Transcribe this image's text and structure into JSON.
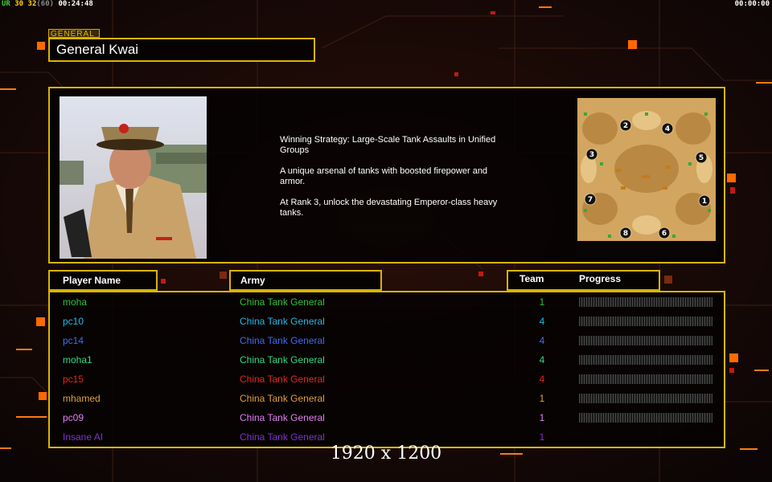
{
  "hud": {
    "left_ur": "UR",
    "left_fps1": "30",
    "left_fps2": "32",
    "left_fps3": "(60)",
    "left_time": "00:24:48",
    "right_time": "00:00:00"
  },
  "general": {
    "tag": "GENERAL",
    "name": "General Kwai",
    "description": [
      "Winning Strategy: Large-Scale Tank Assaults in Unified\n Groups",
      "A unique arsenal of tanks with boosted firepower and\n armor.",
      "At Rank 3, unlock the devastating Emperor-class heavy\n tanks."
    ]
  },
  "map": {
    "start_positions": [
      "1",
      "2",
      "3",
      "4",
      "5",
      "6",
      "7",
      "8"
    ]
  },
  "table": {
    "headers": {
      "player_name": "Player Name",
      "army": "Army",
      "team": "Team",
      "progress": "Progress"
    },
    "rows": [
      {
        "player": "moha",
        "army": "China Tank General",
        "team": "1",
        "color": "#2ec23a"
      },
      {
        "player": "pc10",
        "army": "China Tank General",
        "team": "4",
        "color": "#22b8e6"
      },
      {
        "player": "pc14",
        "army": "China Tank General",
        "team": "4",
        "color": "#3f6bf0"
      },
      {
        "player": "moha1",
        "army": "China Tank General",
        "team": "4",
        "color": "#2ed986"
      },
      {
        "player": "pc15",
        "army": "China Tank General",
        "team": "4",
        "color": "#e6261e"
      },
      {
        "player": "mhamed",
        "army": "China Tank General",
        "team": "1",
        "color": "#e0a040"
      },
      {
        "player": "pc09",
        "army": "China Tank General",
        "team": "1",
        "color": "#e080f0"
      },
      {
        "player": "Insane AI",
        "army": "China Tank General",
        "team": "1",
        "color": "#8030d0"
      }
    ]
  },
  "watermark": "1920 x 1200",
  "colors": {
    "frame": "#d9b400",
    "background": "#120808",
    "accent_orange": "#ff6a00"
  }
}
